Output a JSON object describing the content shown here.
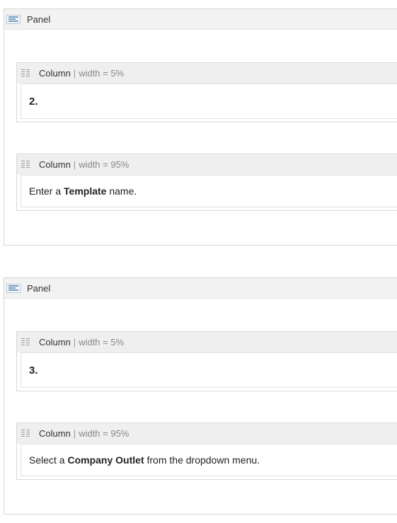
{
  "panels": [
    {
      "title": "Panel",
      "columns": [
        {
          "name": "Column",
          "separator": "|",
          "width_label": "width = 5%",
          "number": "2."
        },
        {
          "name": "Column",
          "separator": "|",
          "width_label": "width = 95%",
          "text_before": "Enter a ",
          "text_bold": "Template",
          "text_after": " name."
        }
      ]
    },
    {
      "title": "Panel",
      "columns": [
        {
          "name": "Column",
          "separator": "|",
          "width_label": "width = 5%",
          "number": "3."
        },
        {
          "name": "Column",
          "separator": "|",
          "width_label": "width = 95%",
          "text_before": "Select a ",
          "text_bold": "Company Outlet",
          "text_after": " from the dropdown menu."
        }
      ]
    }
  ],
  "icons": {
    "panel": "panel-layout-icon",
    "column": "drag-grip-icon"
  }
}
